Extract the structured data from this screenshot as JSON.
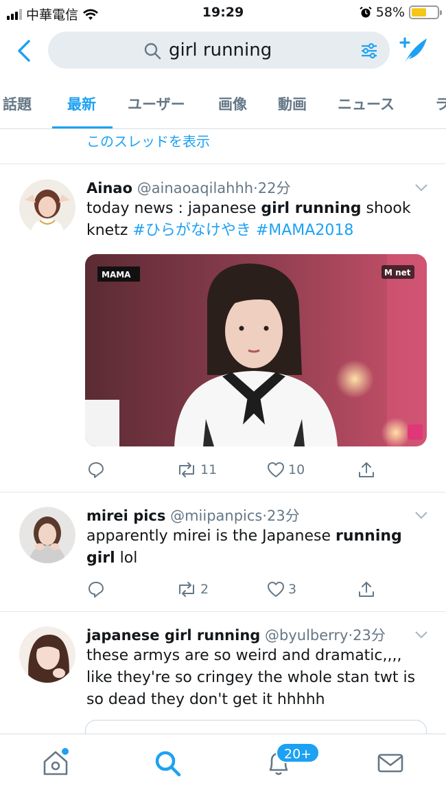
{
  "status_bar": {
    "carrier": "中華電信",
    "time": "19:29",
    "battery_percent": "58%",
    "battery_level": 0.58,
    "icons": [
      "signal-icon",
      "wifi-icon",
      "alarm-icon",
      "battery-icon"
    ]
  },
  "search": {
    "query": "girl running",
    "icons": [
      "back-chevron-icon",
      "search-icon",
      "filter-icon",
      "compose-tweet-icon"
    ]
  },
  "tabs": [
    "話題",
    "最新",
    "ユーザー",
    "画像",
    "動画",
    "ニュース",
    "ラ"
  ],
  "active_tab": "最新",
  "thread_link": "このスレッドを表示",
  "tweets": [
    {
      "name": "Ainao",
      "handle": "@ainaoaqilahhh",
      "time": "22分",
      "text_parts": {
        "p1": "today news : japanese ",
        "b1": "girl running",
        "p2": " shook knetz ",
        "h1": "#ひらがなけやき",
        "h2": "#MAMA2018"
      },
      "media_logos": {
        "left": "MAMA",
        "right": "M net"
      },
      "replies": "",
      "retweets": "11",
      "likes": "10"
    },
    {
      "name": "mirei pics",
      "handle": "@miipanpics",
      "time": "23分",
      "text_parts": {
        "p1": "apparently mirei is the Japanese ",
        "b1": "running girl",
        "p2": " lol"
      },
      "replies": "",
      "retweets": "2",
      "likes": "3"
    },
    {
      "name": "japanese girl running",
      "handle": "@byulberry",
      "time": "23分",
      "text": "these armys are so weird and dramatic,,,, like they're so cringey the whole stan twt is so dead they don't get it hhhhh"
    }
  ],
  "bottom_nav": {
    "items": [
      "home-icon",
      "search-icon",
      "notifications-icon",
      "messages-icon"
    ],
    "notification_badge": "20+",
    "active": "search-icon"
  },
  "colors": {
    "accent": "#1da1f2",
    "text": "#14171a",
    "secondary_text": "#657786",
    "search_bg": "#e6ecf0",
    "battery": "#f5c518"
  }
}
